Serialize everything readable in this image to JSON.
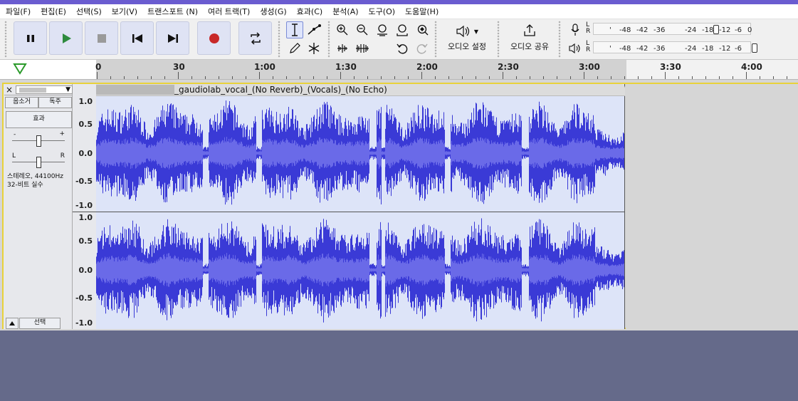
{
  "menu": [
    "파일(F)",
    "편집(E)",
    "선택(S)",
    "보기(V)",
    "트랜스포트 (N)",
    "여러 트랙(T)",
    "생성(G)",
    "효과(C)",
    "분석(A)",
    "도구(O)",
    "도움말(H)"
  ],
  "transport": {
    "pause_icon": "pause-icon",
    "play_icon": "play-icon",
    "stop_icon": "stop-icon",
    "skip_start_icon": "skip-start-icon",
    "skip_end_icon": "skip-end-icon",
    "record_icon": "record-icon",
    "loop_icon": "loop-icon"
  },
  "tools": {
    "selection_icon": "i-beam-icon",
    "envelope_icon": "envelope-icon",
    "draw_icon": "pencil-icon",
    "multi_icon": "multi-tool-icon"
  },
  "audio_setup": {
    "label": "오디오 설정"
  },
  "share_audio": {
    "label": "오디오 공유"
  },
  "meters": {
    "lr_top": "L",
    "lr_bottom": "R",
    "ticks": [
      "-48",
      "-42",
      "-36",
      "-24",
      "-18",
      "-12",
      "-6",
      "0"
    ]
  },
  "timeline": {
    "labels": [
      "0",
      "30",
      "1:00",
      "1:30",
      "2:00",
      "2:30",
      "3:00",
      "3:30",
      "4:00"
    ]
  },
  "track": {
    "close": "×",
    "mute": "음소거",
    "solo": "독주",
    "effects": "효과",
    "gain_minus": "-",
    "gain_plus": "+",
    "pan_left": "L",
    "pan_right": "R",
    "info_line1": "스테레오, 44100Hz",
    "info_line2": "32-비트 실수",
    "select": "선택",
    "clip_name": "_gaudiolab_vocal_(No Reverb)_(Vocals)_(No Echo)",
    "vscale": [
      "1.0",
      "0.5",
      "0.0",
      "-0.5",
      "-1.0"
    ],
    "wave_color": "#3a3ad6",
    "wave_rms_color": "#6a6ae8"
  }
}
